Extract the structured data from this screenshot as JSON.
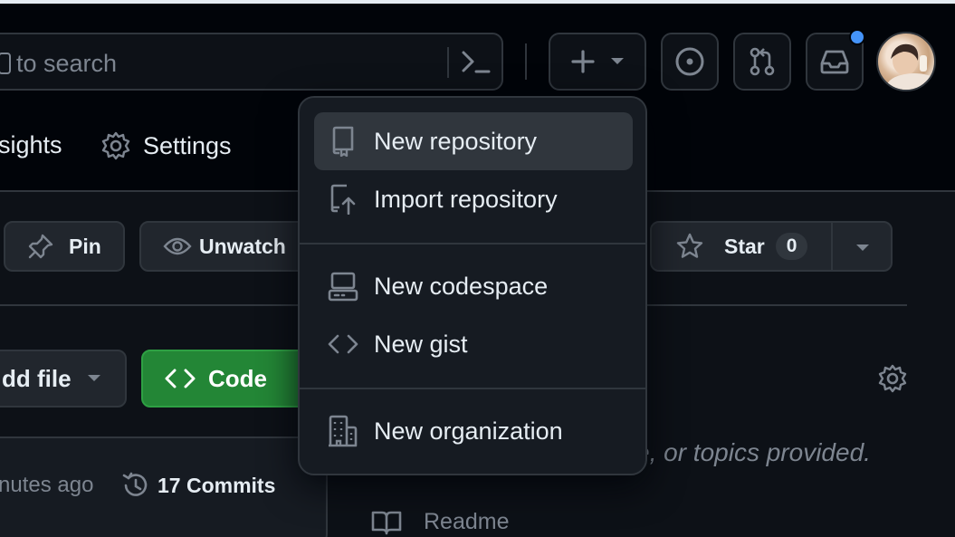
{
  "header": {
    "search_placeholder": "to search",
    "notification_dot_color": "#4493f8"
  },
  "tabs": {
    "insights": "sights",
    "settings": "Settings"
  },
  "repo_actions": {
    "pin": "Pin",
    "unwatch": "Unwatch",
    "star": "Star",
    "star_count": "0"
  },
  "file_bar": {
    "add_file": "dd file",
    "code": "Code"
  },
  "commit_bar": {
    "time": "nutes ago",
    "commits": "17 Commits"
  },
  "about": {
    "description": "e, or topics provided."
  },
  "readme": {
    "label": "Readme"
  },
  "dropdown": {
    "items": [
      {
        "label": "New repository",
        "icon": "repo-icon"
      },
      {
        "label": "Import repository",
        "icon": "repo-push-icon"
      },
      {
        "label": "New codespace",
        "icon": "codespaces-icon"
      },
      {
        "label": "New gist",
        "icon": "code-icon"
      },
      {
        "label": "New organization",
        "icon": "organization-icon"
      }
    ]
  },
  "colors": {
    "accent": "#4493f8",
    "code_button": "#238636"
  }
}
